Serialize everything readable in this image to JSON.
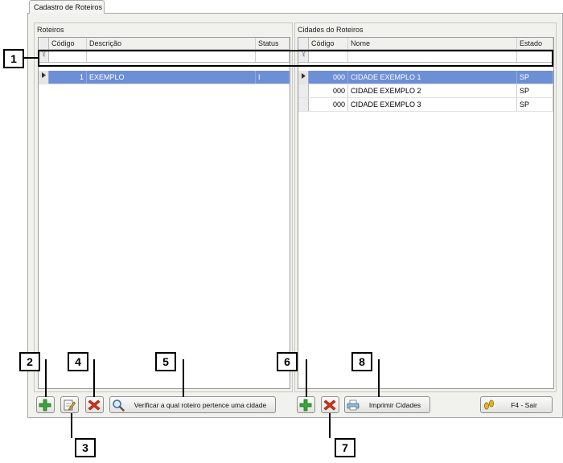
{
  "window": {
    "tab_label": "Cadastro de Roteiros"
  },
  "roteiros": {
    "title": "Roteiros",
    "columns": [
      "Código",
      "Descrição",
      "Status"
    ],
    "rows": [
      {
        "codigo": "1",
        "descricao": "EXEMPLO",
        "status": "I"
      }
    ]
  },
  "cidades": {
    "title": "Cidades do Roteiros",
    "columns": [
      "Código",
      "Nome",
      "Estado"
    ],
    "rows": [
      {
        "codigo": "000",
        "nome": "CIDADE EXEMPLO 1",
        "estado": "SP"
      },
      {
        "codigo": "000",
        "nome": "CIDADE EXEMPLO 2",
        "estado": "SP"
      },
      {
        "codigo": "000",
        "nome": "CIDADE EXEMPLO 3",
        "estado": "SP"
      }
    ]
  },
  "buttons": {
    "verificar": "Verificar a qual roteiro pertence uma cidade",
    "imprimir": "Imprimir Cidades",
    "sair": "F4 - Sair"
  },
  "callouts": [
    "1",
    "2",
    "3",
    "4",
    "5",
    "6",
    "7",
    "8"
  ],
  "icons": {
    "add": "plus-icon",
    "edit": "edit-icon",
    "delete": "delete-icon",
    "search": "magnifier-icon",
    "print": "printer-icon",
    "exit": "footsteps-icon",
    "filter": "filter-icon",
    "row_pointer": "row-pointer-icon"
  },
  "colors": {
    "selection": "#6d8fd6",
    "add": "#3aa53a",
    "delete": "#d8331f"
  }
}
